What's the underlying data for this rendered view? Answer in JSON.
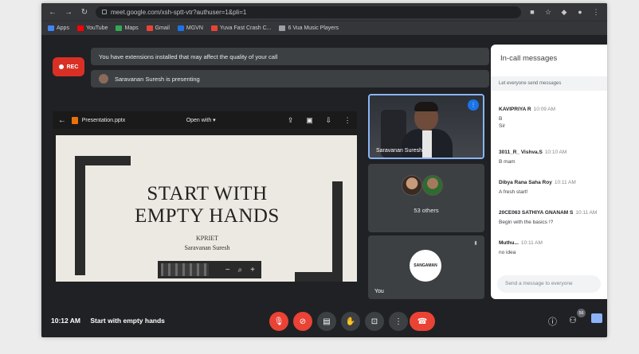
{
  "browser": {
    "url": "meet.google.com/xsh-sptt-vtr?authuser=1&pli=1",
    "bookmarks": [
      {
        "label": "Apps",
        "color": "#4285f4"
      },
      {
        "label": "YouTube",
        "color": "#ff0000"
      },
      {
        "label": "Maps",
        "color": "#34a853"
      },
      {
        "label": "Gmail",
        "color": "#ea4335"
      },
      {
        "label": "MGVN",
        "color": "#1a73e8"
      },
      {
        "label": "Yuva Fast Crash C...",
        "color": "#ea4335"
      },
      {
        "label": "6 Vua Music Players",
        "color": "#9aa0a6"
      }
    ]
  },
  "meet": {
    "rec_label": "REC",
    "banner_extensions": "You have extensions installed that may affect the quality of your call",
    "banner_presenting": "Saravanan Suresh is presenting",
    "presentation": {
      "file_name": "Presentation.pptx",
      "open_with": "Open with ▾",
      "slide_title": "START WITH EMPTY HANDS",
      "slide_org": "KPRIET",
      "slide_author": "Saravanan Suresh"
    },
    "tiles": {
      "speaker_name": "Saravanan Suresh",
      "others_label": "53 others",
      "you_label": "You",
      "you_logo_text": "SANGAMAN"
    },
    "chat": {
      "title": "In-call messages",
      "toggle_text": "Let everyone send messages",
      "messages": [
        {
          "sender": "KAVIPRIYA R",
          "time": "10:09 AM",
          "text": "B\nSir"
        },
        {
          "sender": "3011_R_ Vishva.S",
          "time": "10:10 AM",
          "text": "B mam"
        },
        {
          "sender": "Dibya Rana Saha Roy",
          "time": "10:11 AM",
          "text": "A fresh start!"
        },
        {
          "sender": "20CE063 SATHIYA GNANAM S",
          "time": "10:11 AM",
          "text": "Begin with the basics !?"
        },
        {
          "sender": "Muthu...",
          "time": "10:11 AM",
          "text": "no idea"
        }
      ],
      "input_placeholder": "Send a message to everyone"
    },
    "bottom": {
      "time": "10:12 AM",
      "meeting_name": "Start with empty hands",
      "participants_count": "56"
    }
  },
  "colors": {
    "accent": "#8ab4f8",
    "danger": "#ea4335"
  }
}
